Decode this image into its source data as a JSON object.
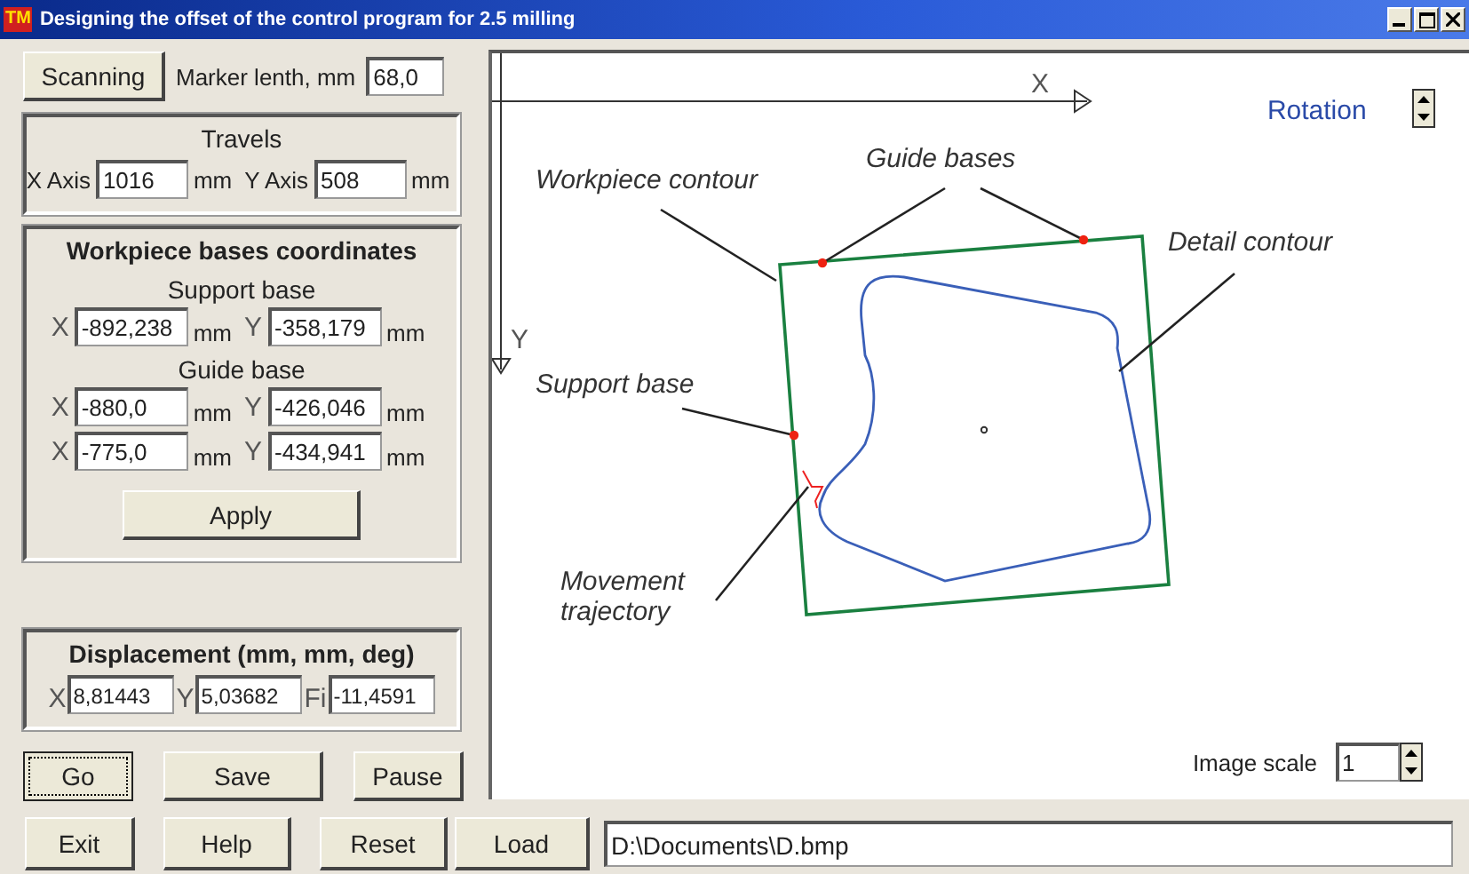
{
  "window": {
    "logo": "TM",
    "title": "Designing the offset of the control program for 2.5 milling"
  },
  "scan": {
    "button": "Scanning",
    "marker_label": "Marker lenth, mm",
    "marker_value": "68,0"
  },
  "travels": {
    "title": "Travels",
    "fields": [
      {
        "label": "X Axis",
        "value": "1016",
        "unit": "mm"
      },
      {
        "label": "Y Axis",
        "value": "508",
        "unit": "mm"
      }
    ]
  },
  "bases": {
    "title": "Workpiece bases coordinates",
    "groups": [
      {
        "title": "Support base",
        "rows": [
          [
            {
              "label": "X",
              "value": "-892,238",
              "unit": "mm"
            },
            {
              "label": "Y",
              "value": "-358,179",
              "unit": "mm"
            }
          ]
        ]
      },
      {
        "title": "Guide base",
        "rows": [
          [
            {
              "label": "X",
              "value": "-880,0",
              "unit": "mm"
            },
            {
              "label": "Y",
              "value": "-426,046",
              "unit": "mm"
            }
          ],
          [
            {
              "label": "X",
              "value": "-775,0",
              "unit": "mm"
            },
            {
              "label": "Y",
              "value": "-434,941",
              "unit": "mm"
            }
          ]
        ]
      }
    ],
    "apply": "Apply"
  },
  "displacement": {
    "title": "Displacement (mm, mm, deg)",
    "fields": [
      {
        "label": "X",
        "value": "8,81443"
      },
      {
        "label": "Y",
        "value": "5,03682"
      },
      {
        "label": "Fi",
        "value": "-11,4591"
      }
    ]
  },
  "action_buttons": [
    {
      "label": "Go",
      "focused": true
    },
    {
      "label": "Save",
      "focused": false
    },
    {
      "label": "Pause",
      "focused": false
    }
  ],
  "bottom_buttons": [
    {
      "label": "Exit",
      "focused": false
    },
    {
      "label": "Help",
      "focused": false
    },
    {
      "label": "Reset",
      "focused": false
    },
    {
      "label": "Load",
      "focused": false
    }
  ],
  "path_field": {
    "value": "D:\\Documents\\D.bmp"
  },
  "canvas": {
    "x_axis": "X",
    "y_axis": "Y",
    "rotation": "Rotation",
    "labels": [
      {
        "kind": "workpiece",
        "text": "Workpiece contour"
      },
      {
        "kind": "guide",
        "text": "Guide bases"
      },
      {
        "kind": "detail",
        "text": "Detail contour"
      },
      {
        "kind": "support",
        "text": "Support base"
      },
      {
        "kind": "trajectory",
        "text": "Movement trajectory"
      }
    ],
    "image_scale": {
      "label": "Image scale",
      "value": "1"
    }
  }
}
